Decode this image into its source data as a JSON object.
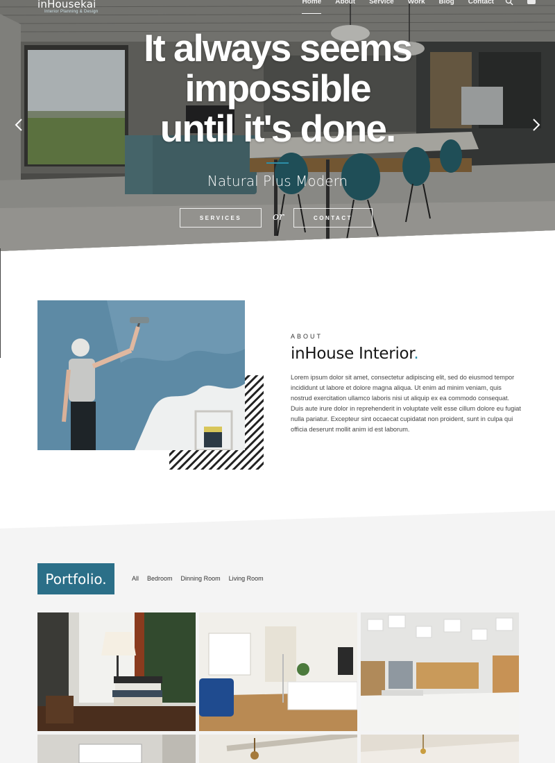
{
  "brand": {
    "name": "inHousekai",
    "tagline": "Interior Planning & Design"
  },
  "nav": {
    "items": [
      {
        "label": "Home",
        "active": true
      },
      {
        "label": "About"
      },
      {
        "label": "Service"
      },
      {
        "label": "Work"
      },
      {
        "label": "Blog"
      },
      {
        "label": "Contact"
      }
    ],
    "icons": [
      "search-icon",
      "cart-icon"
    ]
  },
  "hero": {
    "title_lines": [
      "It always seems",
      "impossible",
      "until it's done."
    ],
    "subtitle": "Natural Plus Modern",
    "primary_button": "SERVICES",
    "separator": "or",
    "secondary_button": "CONTACT",
    "accent_color": "#2d8ea8",
    "icons": [
      "chevron-left-icon",
      "chevron-right-icon"
    ]
  },
  "about": {
    "eyebrow": "ABOUT",
    "title": "inHouse Interior",
    "title_suffix": ".",
    "body": "Lorem ipsum dolor sit amet, consectetur adipiscing elit, sed do eiusmod tempor incididunt ut labore et dolore magna aliqua. Ut enim ad minim veniam, quis nostrud exercitation ullamco laboris nisi ut aliquip ex ea commodo consequat. Duis aute irure dolor in reprehenderit in voluptate velit esse cillum dolore eu fugiat nulla pariatur. Excepteur sint occaecat cupidatat non proident, sunt in culpa qui officia deserunt mollit anim id est laborum."
  },
  "portfolio": {
    "title": "Portfolio.",
    "brand_color": "#2b6f88",
    "filters": [
      "All",
      "Bedroom",
      "Dinning Room",
      "Living Room"
    ]
  }
}
